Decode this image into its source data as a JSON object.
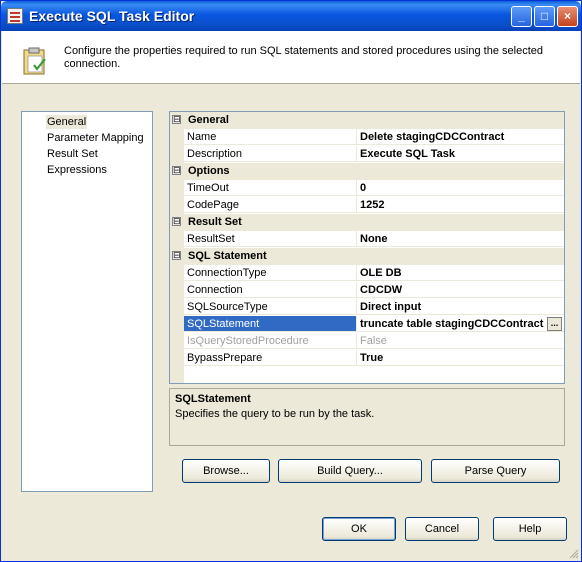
{
  "window": {
    "title": "Execute SQL Task Editor",
    "controls": [
      "_",
      "□",
      "×"
    ]
  },
  "header": {
    "description": "Configure the properties required to run SQL statements and stored procedures using the selected connection."
  },
  "nav": {
    "items": [
      "General",
      "Parameter Mapping",
      "Result Set",
      "Expressions"
    ],
    "selected": "General"
  },
  "grid": {
    "categories": [
      {
        "label": "General",
        "toggle": "⊟",
        "props": [
          {
            "name": "Name",
            "value": "Delete stagingCDCContract"
          },
          {
            "name": "Description",
            "value": "Execute SQL Task"
          }
        ]
      },
      {
        "label": "Options",
        "toggle": "⊟",
        "props": [
          {
            "name": "TimeOut",
            "value": "0"
          },
          {
            "name": "CodePage",
            "value": "1252"
          }
        ]
      },
      {
        "label": "Result Set",
        "toggle": "⊟",
        "props": [
          {
            "name": "ResultSet",
            "value": "None"
          }
        ]
      },
      {
        "label": "SQL Statement",
        "toggle": "⊟",
        "props": [
          {
            "name": "ConnectionType",
            "value": "OLE DB"
          },
          {
            "name": "Connection",
            "value": "CDCDW"
          },
          {
            "name": "SQLSourceType",
            "value": "Direct input"
          },
          {
            "name": "SQLStatement",
            "value": "truncate table stagingCDCContract",
            "selected": true,
            "ellipsis": "..."
          },
          {
            "name": "IsQueryStoredProcedure",
            "value": "False",
            "disabled": true
          },
          {
            "name": "BypassPrepare",
            "value": "True"
          }
        ]
      }
    ]
  },
  "description_panel": {
    "title": "SQLStatement",
    "text": "Specifies the query to be run by the task."
  },
  "buttons": {
    "browse": "Browse...",
    "build_query": "Build Query...",
    "parse_query": "Parse Query",
    "ok": "OK",
    "cancel": "Cancel",
    "help": "Help"
  }
}
